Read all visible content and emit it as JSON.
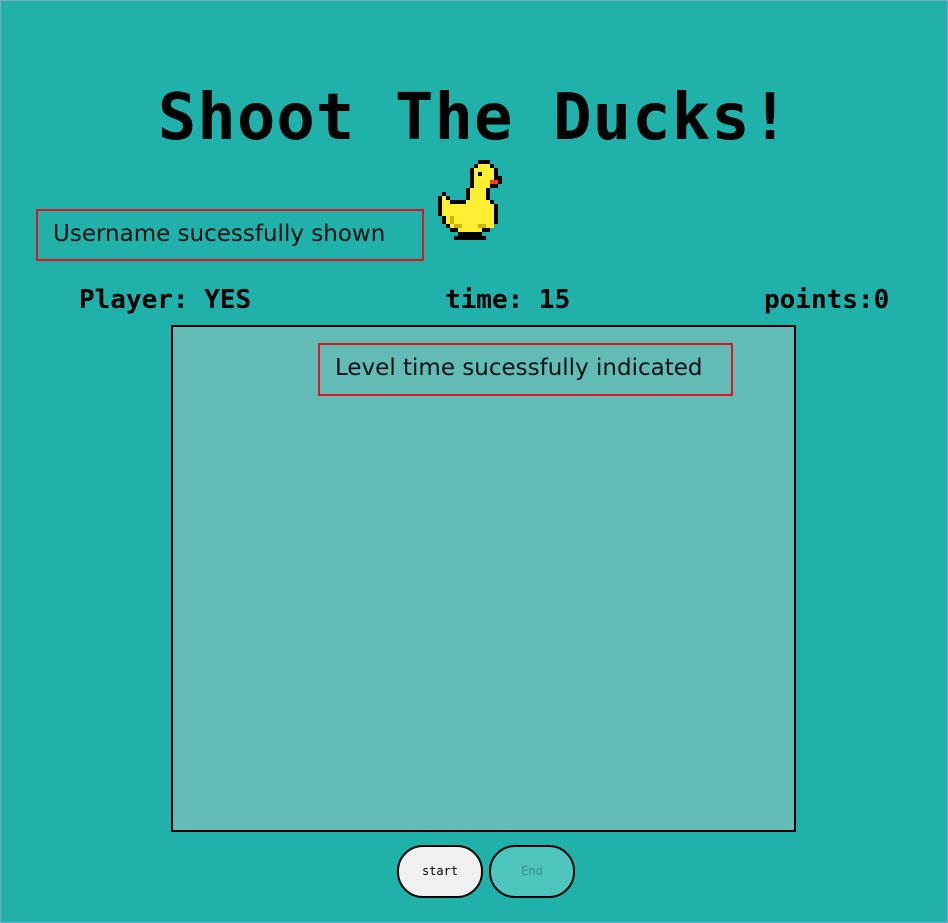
{
  "game": {
    "title": "Shoot The Ducks!"
  },
  "status": {
    "player": "Player: YES",
    "time": "time: 15",
    "points": "points:0"
  },
  "annotations": {
    "username": "Username sucessfully shown",
    "level_time": "Level time sucessfully indicated"
  },
  "controls": {
    "start_label": "start",
    "end_label": "End"
  },
  "icons": {
    "duck": "duck-icon"
  },
  "colors": {
    "background": "#20b2aa",
    "game_area": "#62bbb4",
    "annotation_border": "#e0141e",
    "duck_body": "#ffee33",
    "duck_beak": "#ff3b1f"
  }
}
